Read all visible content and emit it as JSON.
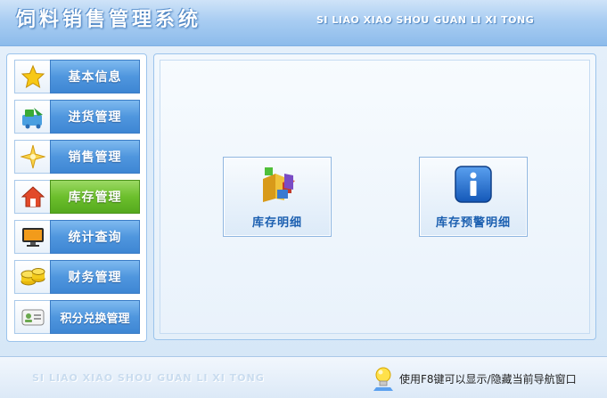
{
  "header": {
    "title": "饲料销售管理系统",
    "subtitle": "SI LIAO XIAO SHOU GUAN LI XI TONG"
  },
  "sidebar": {
    "items": [
      {
        "label": "基本信息",
        "icon": "star-icon",
        "active": false
      },
      {
        "label": "进货管理",
        "icon": "purchase-icon",
        "active": false
      },
      {
        "label": "销售管理",
        "icon": "sparkle-star-icon",
        "active": false
      },
      {
        "label": "库存管理",
        "icon": "house-icon",
        "active": true
      },
      {
        "label": "统计查询",
        "icon": "monitor-icon",
        "active": false
      },
      {
        "label": "财务管理",
        "icon": "coins-icon",
        "active": false
      },
      {
        "label": "积分兑换管理",
        "icon": "member-card-icon",
        "active": false
      }
    ]
  },
  "main": {
    "tiles": [
      {
        "label": "库存明细",
        "icon": "inventory-blocks-icon"
      },
      {
        "label": "库存预警明细",
        "icon": "info-icon"
      }
    ]
  },
  "footer": {
    "watermark": "SI LIAO XIAO SHOU GUAN LI XI TONG",
    "hint": "使用F8键可以显示/隐藏当前导航窗口",
    "hint_icon": "lightbulb-icon"
  },
  "colors": {
    "nav_blue": "#4f96de",
    "nav_active_green": "#6cbf2c",
    "tile_text": "#1b5fb0",
    "background": "#dbe9f7"
  }
}
